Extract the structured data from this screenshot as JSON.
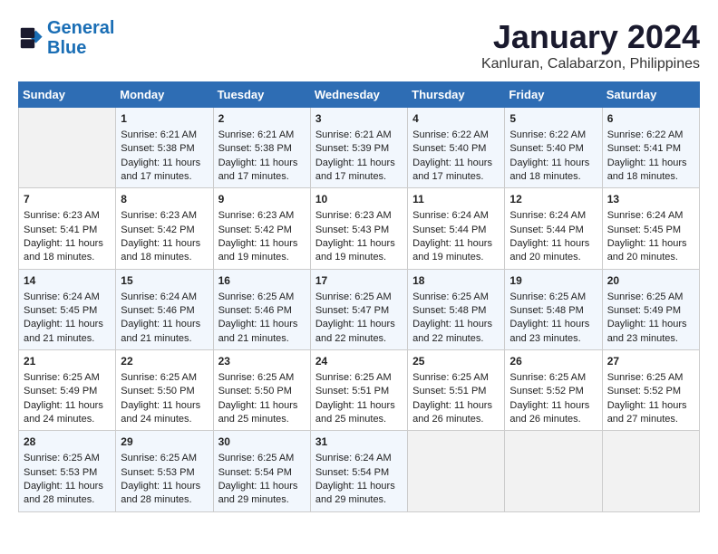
{
  "logo": {
    "line1": "General",
    "line2": "Blue"
  },
  "title": "January 2024",
  "location": "Kanluran, Calabarzon, Philippines",
  "days_of_week": [
    "Sunday",
    "Monday",
    "Tuesday",
    "Wednesday",
    "Thursday",
    "Friday",
    "Saturday"
  ],
  "weeks": [
    [
      {
        "day": "",
        "empty": true
      },
      {
        "day": "1",
        "sunrise": "6:21 AM",
        "sunset": "5:38 PM",
        "daylight": "11 hours and 17 minutes."
      },
      {
        "day": "2",
        "sunrise": "6:21 AM",
        "sunset": "5:38 PM",
        "daylight": "11 hours and 17 minutes."
      },
      {
        "day": "3",
        "sunrise": "6:21 AM",
        "sunset": "5:39 PM",
        "daylight": "11 hours and 17 minutes."
      },
      {
        "day": "4",
        "sunrise": "6:22 AM",
        "sunset": "5:40 PM",
        "daylight": "11 hours and 17 minutes."
      },
      {
        "day": "5",
        "sunrise": "6:22 AM",
        "sunset": "5:40 PM",
        "daylight": "11 hours and 18 minutes."
      },
      {
        "day": "6",
        "sunrise": "6:22 AM",
        "sunset": "5:41 PM",
        "daylight": "11 hours and 18 minutes."
      }
    ],
    [
      {
        "day": "7",
        "sunrise": "6:23 AM",
        "sunset": "5:41 PM",
        "daylight": "11 hours and 18 minutes."
      },
      {
        "day": "8",
        "sunrise": "6:23 AM",
        "sunset": "5:42 PM",
        "daylight": "11 hours and 18 minutes."
      },
      {
        "day": "9",
        "sunrise": "6:23 AM",
        "sunset": "5:42 PM",
        "daylight": "11 hours and 19 minutes."
      },
      {
        "day": "10",
        "sunrise": "6:23 AM",
        "sunset": "5:43 PM",
        "daylight": "11 hours and 19 minutes."
      },
      {
        "day": "11",
        "sunrise": "6:24 AM",
        "sunset": "5:44 PM",
        "daylight": "11 hours and 19 minutes."
      },
      {
        "day": "12",
        "sunrise": "6:24 AM",
        "sunset": "5:44 PM",
        "daylight": "11 hours and 20 minutes."
      },
      {
        "day": "13",
        "sunrise": "6:24 AM",
        "sunset": "5:45 PM",
        "daylight": "11 hours and 20 minutes."
      }
    ],
    [
      {
        "day": "14",
        "sunrise": "6:24 AM",
        "sunset": "5:45 PM",
        "daylight": "11 hours and 21 minutes."
      },
      {
        "day": "15",
        "sunrise": "6:24 AM",
        "sunset": "5:46 PM",
        "daylight": "11 hours and 21 minutes."
      },
      {
        "day": "16",
        "sunrise": "6:25 AM",
        "sunset": "5:46 PM",
        "daylight": "11 hours and 21 minutes."
      },
      {
        "day": "17",
        "sunrise": "6:25 AM",
        "sunset": "5:47 PM",
        "daylight": "11 hours and 22 minutes."
      },
      {
        "day": "18",
        "sunrise": "6:25 AM",
        "sunset": "5:48 PM",
        "daylight": "11 hours and 22 minutes."
      },
      {
        "day": "19",
        "sunrise": "6:25 AM",
        "sunset": "5:48 PM",
        "daylight": "11 hours and 23 minutes."
      },
      {
        "day": "20",
        "sunrise": "6:25 AM",
        "sunset": "5:49 PM",
        "daylight": "11 hours and 23 minutes."
      }
    ],
    [
      {
        "day": "21",
        "sunrise": "6:25 AM",
        "sunset": "5:49 PM",
        "daylight": "11 hours and 24 minutes."
      },
      {
        "day": "22",
        "sunrise": "6:25 AM",
        "sunset": "5:50 PM",
        "daylight": "11 hours and 24 minutes."
      },
      {
        "day": "23",
        "sunrise": "6:25 AM",
        "sunset": "5:50 PM",
        "daylight": "11 hours and 25 minutes."
      },
      {
        "day": "24",
        "sunrise": "6:25 AM",
        "sunset": "5:51 PM",
        "daylight": "11 hours and 25 minutes."
      },
      {
        "day": "25",
        "sunrise": "6:25 AM",
        "sunset": "5:51 PM",
        "daylight": "11 hours and 26 minutes."
      },
      {
        "day": "26",
        "sunrise": "6:25 AM",
        "sunset": "5:52 PM",
        "daylight": "11 hours and 26 minutes."
      },
      {
        "day": "27",
        "sunrise": "6:25 AM",
        "sunset": "5:52 PM",
        "daylight": "11 hours and 27 minutes."
      }
    ],
    [
      {
        "day": "28",
        "sunrise": "6:25 AM",
        "sunset": "5:53 PM",
        "daylight": "11 hours and 28 minutes."
      },
      {
        "day": "29",
        "sunrise": "6:25 AM",
        "sunset": "5:53 PM",
        "daylight": "11 hours and 28 minutes."
      },
      {
        "day": "30",
        "sunrise": "6:25 AM",
        "sunset": "5:54 PM",
        "daylight": "11 hours and 29 minutes."
      },
      {
        "day": "31",
        "sunrise": "6:24 AM",
        "sunset": "5:54 PM",
        "daylight": "11 hours and 29 minutes."
      },
      {
        "day": "",
        "empty": true
      },
      {
        "day": "",
        "empty": true
      },
      {
        "day": "",
        "empty": true
      }
    ]
  ]
}
